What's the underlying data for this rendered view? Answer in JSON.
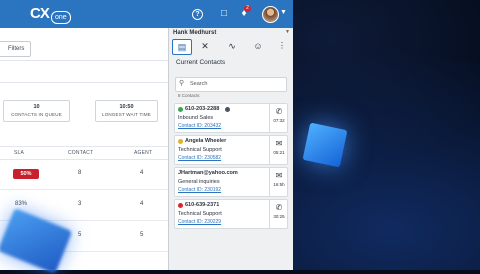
{
  "colors": {
    "topbar": "#2a74c0",
    "sla_red": "#c8202c",
    "link": "#2a74c0",
    "ready": "#35a853",
    "hold": "#e0b12a",
    "busy": "#d9272e"
  },
  "app": {
    "logo_main": "CX",
    "logo_sub": "one"
  },
  "topbar": {
    "icons": [
      "help-icon",
      "inbox-icon",
      "bell-icon",
      "user-avatar",
      "chevron-down-icon"
    ],
    "notification_count": "2"
  },
  "main": {
    "filter_label": "Filters",
    "stats": [
      {
        "value": "10",
        "label": "CONTACTS IN QUEUE"
      },
      {
        "value": "10:50",
        "label": "LONGEST WAIT TIME"
      }
    ],
    "columns": [
      "SLA",
      "CONTACT",
      "AGENT"
    ],
    "rows": [
      {
        "sla": "50%",
        "contact": "8",
        "agent": "4"
      },
      {
        "sla": "83%",
        "contact": "3",
        "agent": "4"
      },
      {
        "sla": "5",
        "contact": "5",
        "agent": "5"
      }
    ]
  },
  "panel": {
    "agent_name": "Hank Medhurst",
    "tabs": [
      "contacts-card-icon",
      "tools-icon",
      "activity-icon",
      "head-icon",
      "more-icon"
    ],
    "title": "Current Contacts",
    "search_placeholder": "Search",
    "count": "8 Contacts",
    "contacts": [
      {
        "name": "610-203-2288",
        "skill": "Inbound Sales",
        "contact_id": "Contact ID: 203432",
        "channel": "phone",
        "time": "07:32",
        "status": "ready"
      },
      {
        "name": "Angela Wheeler",
        "skill": "Technical Support",
        "contact_id": "Contact ID: 230582",
        "channel": "chat",
        "time": "05:21",
        "status": "hold"
      },
      {
        "name": "JHartman@yahoo.com",
        "skill": "General inquiries",
        "contact_id": "Contact ID: 230192",
        "channel": "email",
        "time": "16:5h",
        "status": "none"
      },
      {
        "name": "610-639-2371",
        "skill": "Technical Support",
        "contact_id": "Contact ID: 230229",
        "channel": "phone",
        "time": "30:25",
        "status": "busy"
      }
    ]
  }
}
